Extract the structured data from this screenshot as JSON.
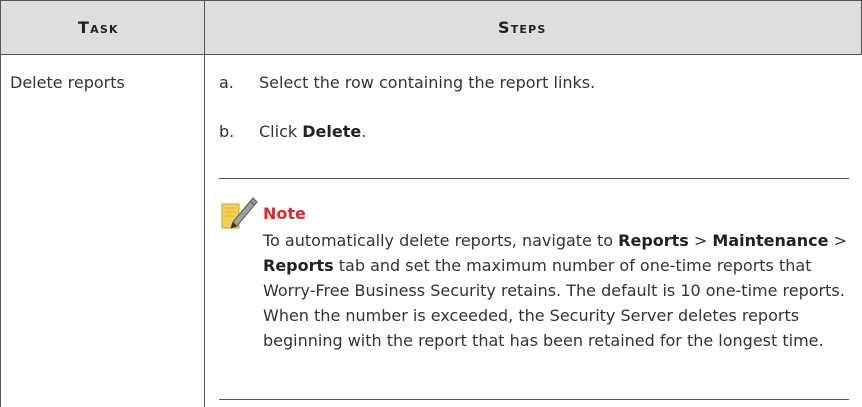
{
  "header": {
    "task": "Task",
    "steps": "Steps"
  },
  "row": {
    "task": "Delete reports",
    "steps": [
      {
        "marker": "a.",
        "text": "Select the row containing the report links."
      },
      {
        "marker": "b.",
        "prefix": "Click ",
        "bold": "Delete",
        "suffix": "."
      }
    ]
  },
  "note": {
    "title": "Note",
    "icon": "pencil-note-icon",
    "body": {
      "t1": "To automatically delete reports, navigate to ",
      "b1": "Reports",
      "t2": " > ",
      "b2": "Maintenance",
      "t3": " > ",
      "b3": "Reports",
      "t4": " tab and set the maximum number of one-time reports that Worry-Free Business Security retains. The default is 10 one-time reports. When the number is exceeded, the Security Server deletes reports beginning with the report that has been retained for the longest time."
    }
  },
  "colors": {
    "header_bg": "#dedede",
    "note_title": "#e2282d",
    "note_icon_yellow": "#f3cf55"
  }
}
